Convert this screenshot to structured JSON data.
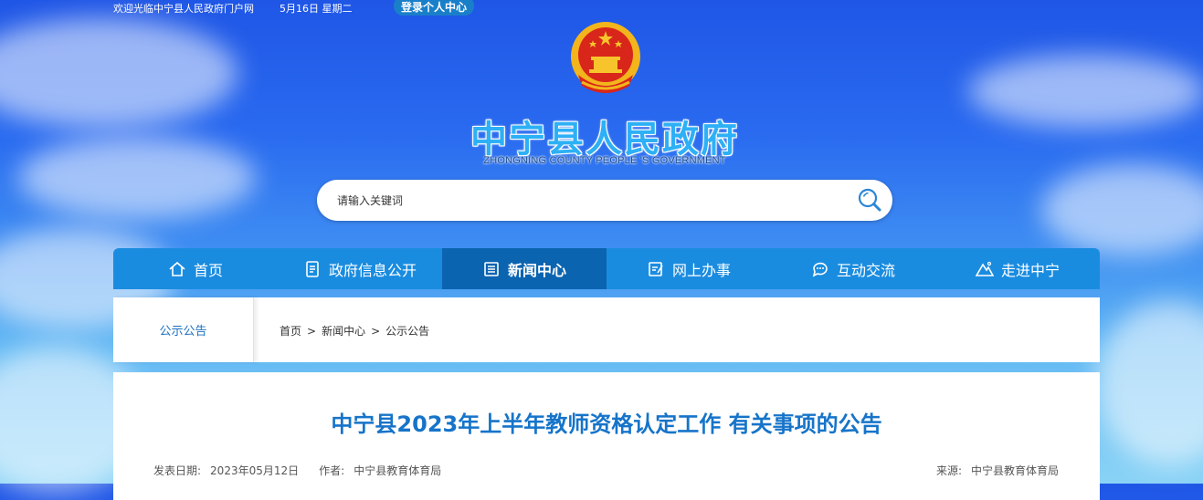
{
  "topbar": {
    "welcome": "欢迎光临中宁县人民政府门户网",
    "date": "5月16日 星期二",
    "login_label": "登录个人中心"
  },
  "header": {
    "title": "中宁县人民政府",
    "subtitle": "ZHONGNING COUNTY PEOPLE 'S GOVERNMENT"
  },
  "search": {
    "placeholder": "请输入关键词",
    "icon": "search-icon"
  },
  "nav": {
    "items": [
      {
        "label": "首页",
        "icon": "home-icon"
      },
      {
        "label": "政府信息公开",
        "icon": "document-icon"
      },
      {
        "label": "新闻中心",
        "icon": "news-icon",
        "active": true
      },
      {
        "label": "网上办事",
        "icon": "edit-doc-icon"
      },
      {
        "label": "互动交流",
        "icon": "chat-icon"
      },
      {
        "label": "走进中宁",
        "icon": "mountain-icon"
      }
    ]
  },
  "section": {
    "name": "公示公告",
    "breadcrumbs": [
      "首页",
      "新闻中心",
      "公示公告"
    ],
    "separator": ">"
  },
  "article": {
    "title": "中宁县2023年上半年教师资格认定工作 有关事项的公告",
    "date_label": "发表日期:",
    "date": "2023年05月12日",
    "author_label": "作者:",
    "author": "中宁县教育体育局",
    "source_label": "来源:",
    "source": "中宁县教育体育局"
  },
  "colors": {
    "nav_bg": "#1a8ce0",
    "nav_active": "#0b64b0",
    "title_blue": "#1674c9"
  }
}
